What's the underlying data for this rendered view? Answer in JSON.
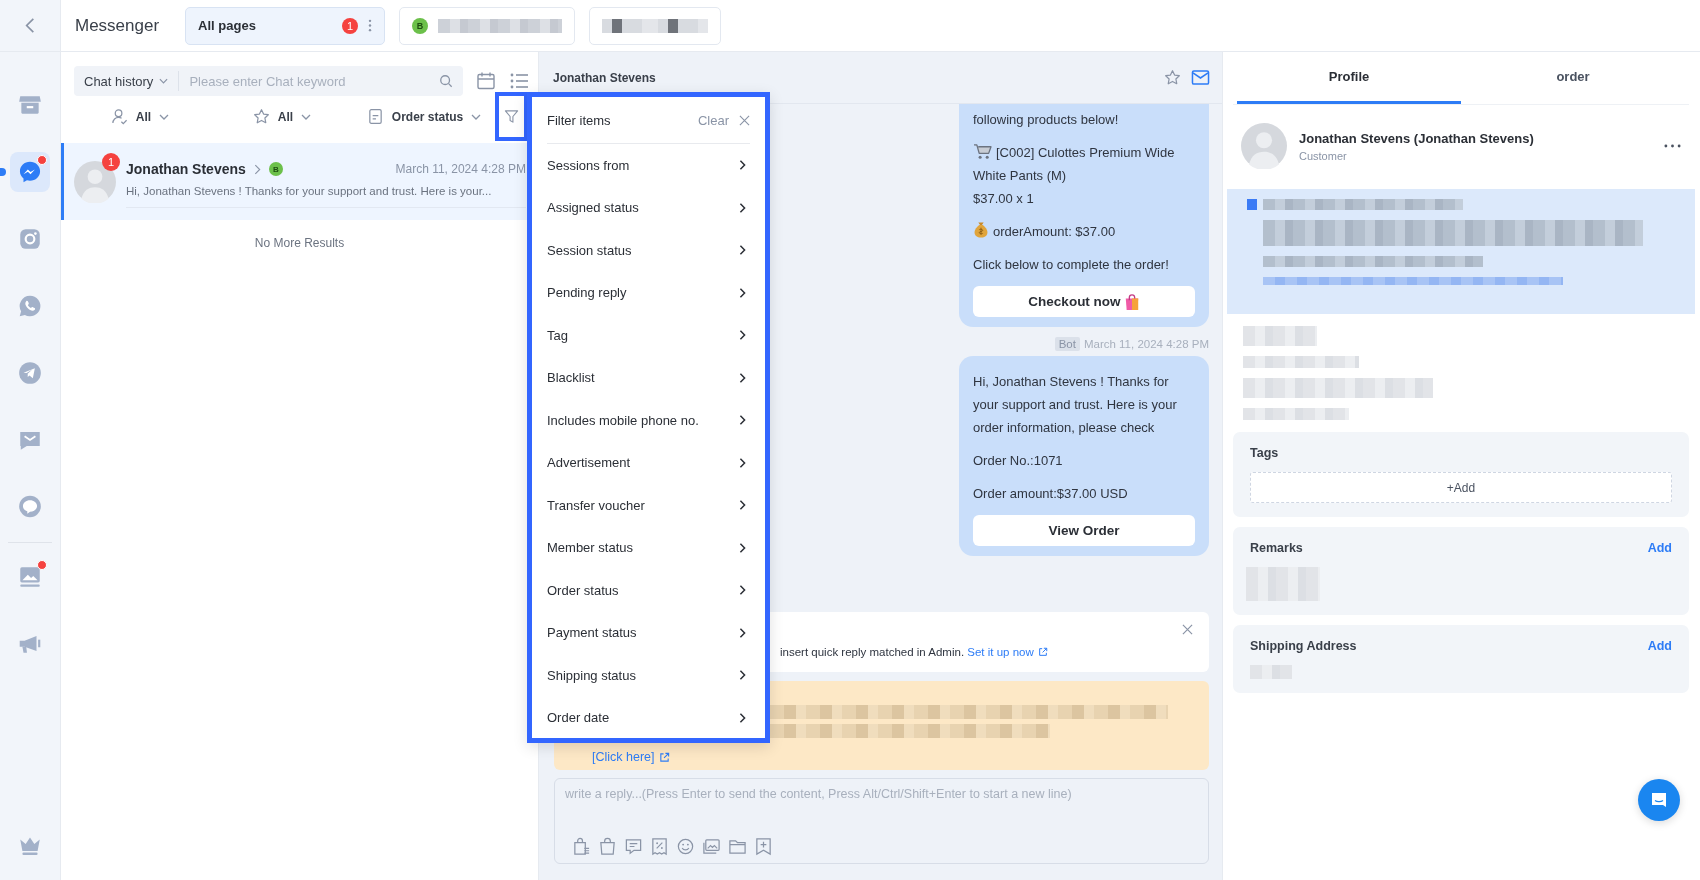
{
  "rail": {
    "channels": [
      {
        "kind": "store",
        "selected": false,
        "unread": false
      },
      {
        "kind": "messenger",
        "selected": true,
        "unread": true
      },
      {
        "kind": "instagram",
        "selected": false,
        "unread": false
      },
      {
        "kind": "whatsapp",
        "selected": false,
        "unread": false
      },
      {
        "kind": "telegram",
        "selected": false,
        "unread": false
      },
      {
        "kind": "sms",
        "selected": false,
        "unread": false
      },
      {
        "kind": "line",
        "selected": false,
        "unread": false
      }
    ],
    "tools": [
      {
        "kind": "gallery",
        "selected": false,
        "unread": true
      },
      {
        "kind": "broadcast",
        "selected": false,
        "unread": false
      }
    ]
  },
  "header": {
    "title": "Messenger",
    "page_tabs": [
      {
        "kind": "all",
        "label": "All pages",
        "badge": "1",
        "selected": true
      },
      {
        "kind": "page",
        "avatar": "B",
        "selected": false
      },
      {
        "kind": "page",
        "selected": false
      }
    ]
  },
  "chat_list": {
    "search": {
      "scope": "Chat history",
      "placeholder": "Please enter Chat keyword"
    },
    "filters": [
      {
        "kind": "assignee",
        "label": "All"
      },
      {
        "kind": "star",
        "label": "All"
      },
      {
        "kind": "order",
        "label": "Order status"
      }
    ],
    "filter_active": true,
    "conversations": [
      {
        "name": "Jonathan Stevens",
        "unread": "1",
        "page_badge": "B",
        "time": "March 11, 2024 4:28 PM",
        "preview": "Hi, Jonathan Stevens ! Thanks for your support and trust. Here is your...",
        "selected": true
      }
    ],
    "end_note": "No More Results"
  },
  "filter_menu": {
    "title": "Filter items",
    "clear": "Clear",
    "items": [
      "Sessions from",
      "Assigned status",
      "Session status",
      "Pending reply",
      "Tag",
      "Blacklist",
      "Includes mobile phone no.",
      "Advertisement",
      "Transfer voucher",
      "Member status",
      "Order status",
      "Payment status",
      "Shipping status",
      "Order date"
    ]
  },
  "conversation": {
    "contact": "Jonathan Stevens",
    "starred": false,
    "messages": [
      {
        "continued": true,
        "paragraphs": [
          {
            "kind": "plain",
            "lines": [
              "following products below!"
            ]
          },
          {
            "kind": "cart",
            "lines": [
              "[C002] Culottes Premium Wide White Pants (M)",
              "$37.00 x 1"
            ]
          },
          {
            "kind": "money",
            "lines": [
              "orderAmount: $37.00"
            ]
          },
          {
            "kind": "plain",
            "lines": [
              "Click below to complete the order!"
            ]
          }
        ],
        "button": {
          "label": "Checkout now",
          "kind": "bag"
        }
      },
      {
        "continued": false,
        "sender": "Bot",
        "time": "March 11, 2024 4:28 PM",
        "paragraphs": [
          {
            "kind": "plain",
            "lines": [
              "Hi, Jonathan Stevens ! Thanks for your support and trust. Here is your order information, please check"
            ]
          },
          {
            "kind": "plain",
            "lines": [
              "Order No.:1071"
            ]
          },
          {
            "kind": "plain",
            "lines": [
              "Order amount:$37.00 USD"
            ]
          }
        ],
        "button": {
          "label": "View Order",
          "kind": "plain"
        }
      }
    ],
    "notice": {
      "text": "insert quick reply matched in Admin.",
      "link": "Set it up now"
    },
    "banner": {
      "link": "[Click here]"
    },
    "composer": {
      "placeholder": "write a reply...(Press Enter to send the content, Press Alt/Ctrl/Shift+Enter to start a new line)"
    }
  },
  "profile_panel": {
    "tabs": [
      {
        "label": "Profile",
        "selected": true
      },
      {
        "label": "order",
        "selected": false
      }
    ],
    "name": "Jonathan Stevens (Jonathan Stevens)",
    "role": "Customer",
    "sections": [
      {
        "kind": "tags",
        "title": "Tags",
        "action": "+Add"
      },
      {
        "kind": "remarks",
        "title": "Remarks",
        "action": "Add"
      },
      {
        "kind": "address",
        "title": "Shipping Address",
        "action": "Add"
      }
    ]
  }
}
